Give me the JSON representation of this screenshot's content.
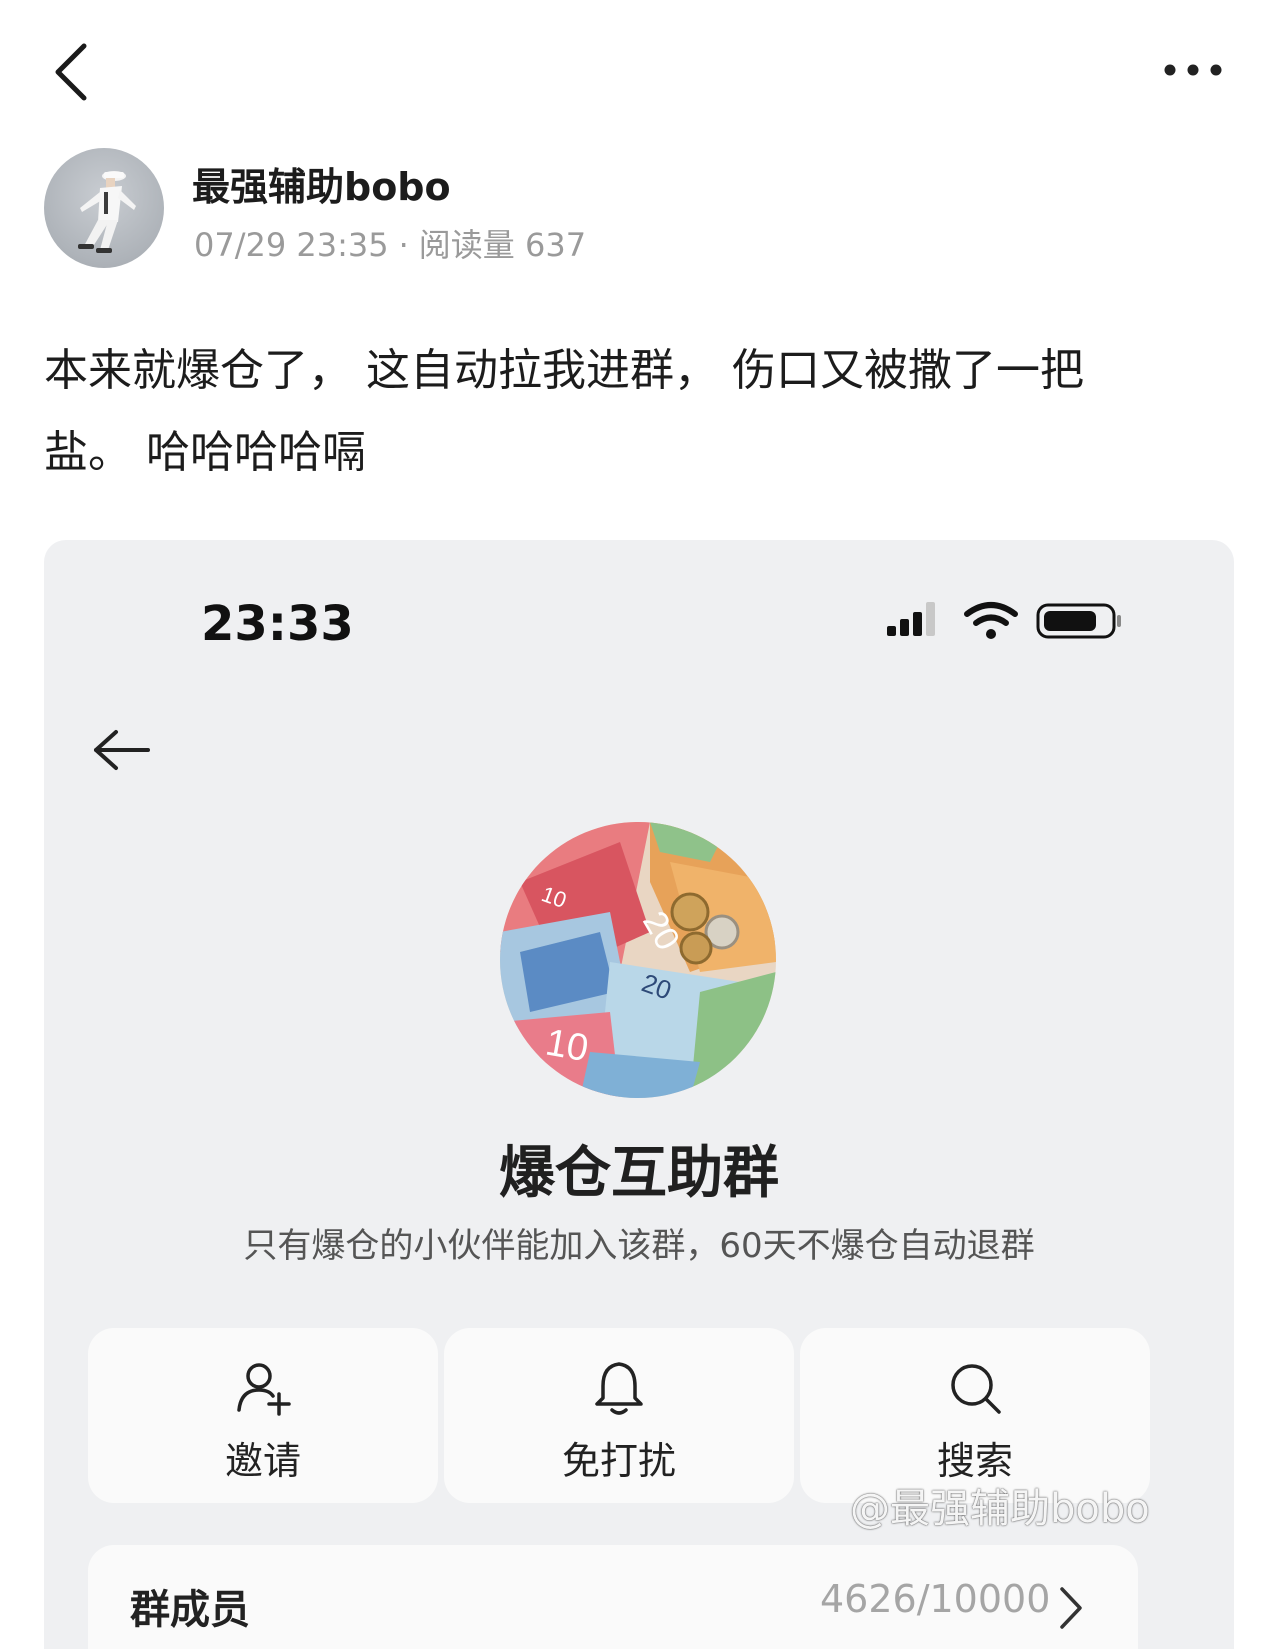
{
  "post": {
    "author_name": "最强辅助bobo",
    "date": "07/29 23:35",
    "separator": "·",
    "read_label": "阅读量",
    "read_count": "637",
    "text_line1": "本来就爆仓了， 这自动拉我进群， 伤口又被撒了一把",
    "text_line2": "盐。 哈哈哈哈嗝"
  },
  "screenshot": {
    "status_time": "23:33",
    "group_name": "爆仓互助群",
    "group_desc": "只有爆仓的小伙伴能加入该群，60天不爆仓自动退群",
    "actions": [
      {
        "label": "邀请",
        "icon": "add-user-icon"
      },
      {
        "label": "免打扰",
        "icon": "bell-icon"
      },
      {
        "label": "搜索",
        "icon": "search-icon"
      }
    ],
    "members_label": "群成员",
    "members_count": "4626/10000"
  },
  "watermark": "@最强辅助bobo"
}
